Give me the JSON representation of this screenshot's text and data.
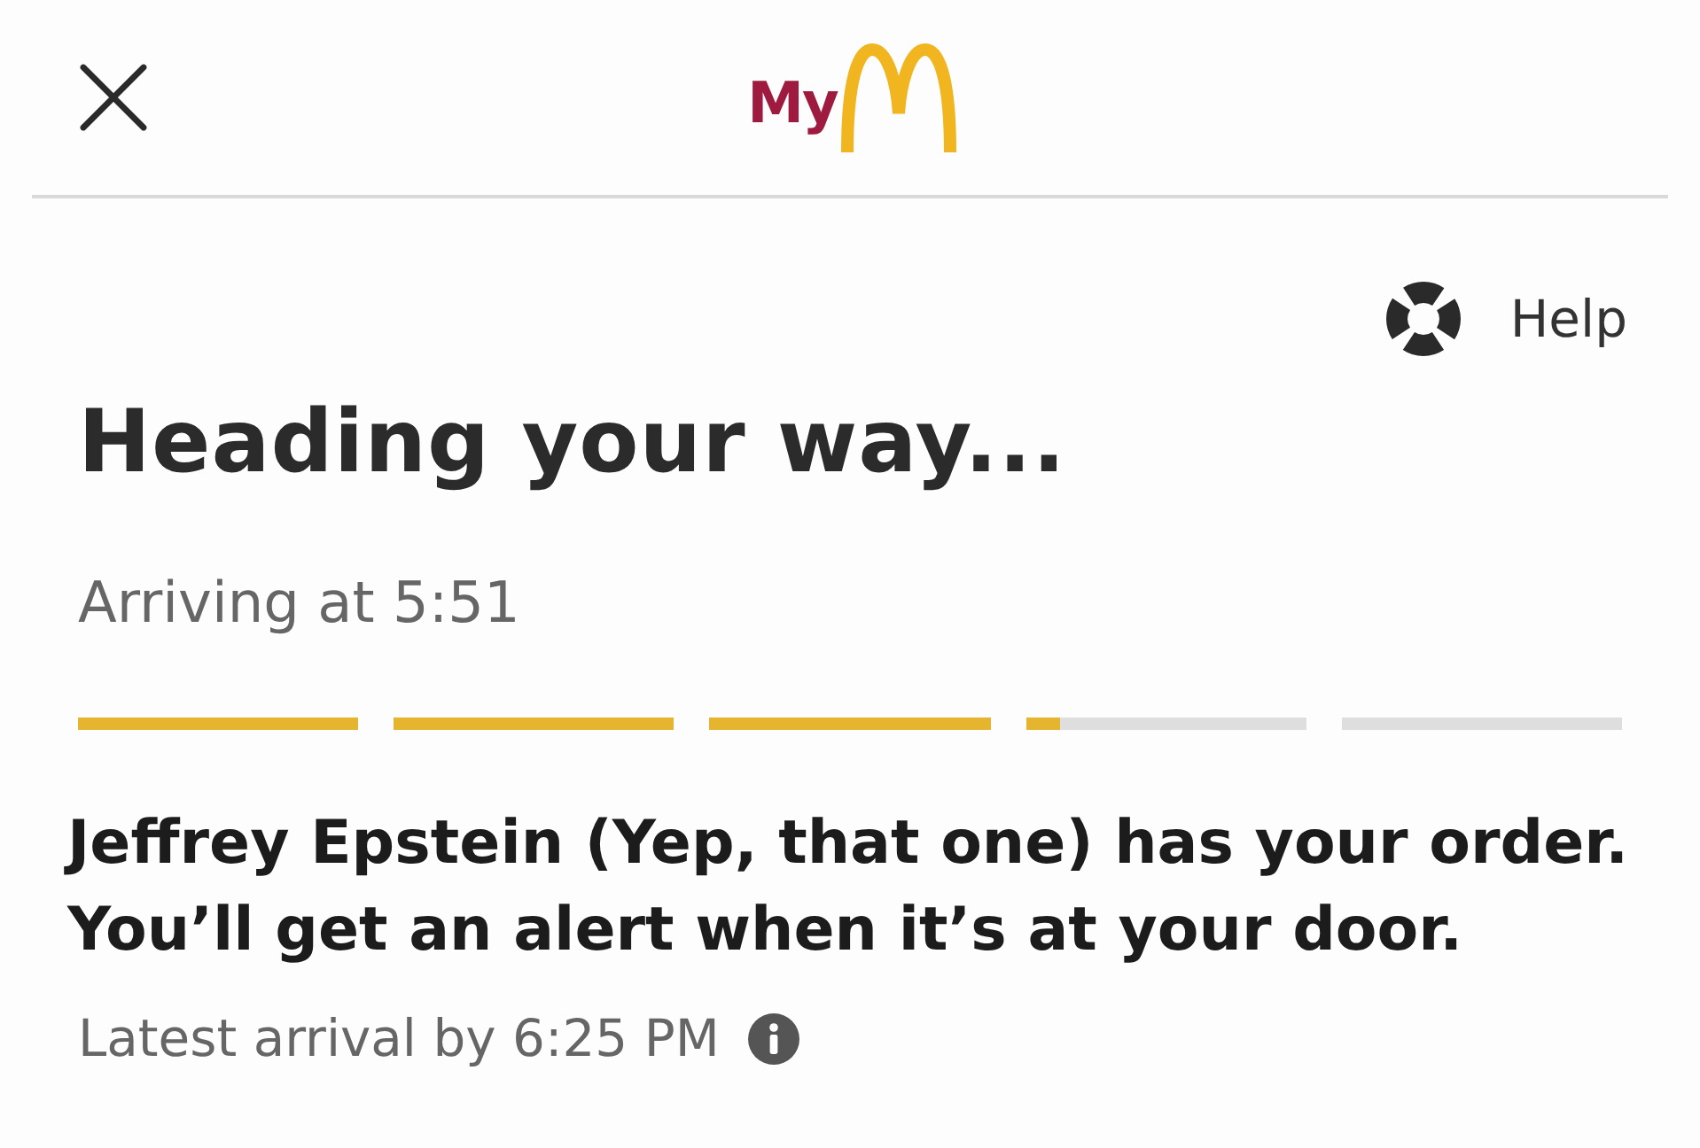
{
  "header": {
    "logo_text": "My"
  },
  "help": {
    "label": "Help"
  },
  "status": {
    "title": "Heading your way...",
    "arrival": "Arriving at 5:51"
  },
  "progress": [
    {
      "level": 1
    },
    {
      "level": 1
    },
    {
      "level": 1
    },
    {
      "level": 0.12
    },
    {
      "level": 0
    }
  ],
  "message": "Jeffrey Epstein (Yep, that one) has your order. You’ll get an alert when it’s at your door.",
  "latest_arrival": "Latest arrival by 6:25 PM"
}
